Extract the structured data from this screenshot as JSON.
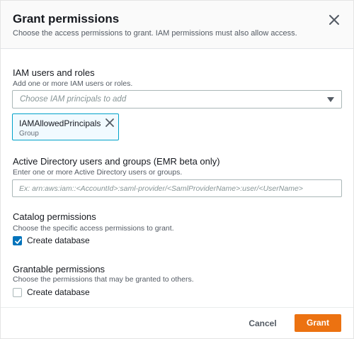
{
  "dialog": {
    "title": "Grant permissions",
    "subtitle": "Choose the access permissions to grant. IAM permissions must also allow access."
  },
  "iam": {
    "label": "IAM users and roles",
    "help": "Add one or more IAM users or roles.",
    "placeholder": "Choose IAM principals to add",
    "token": {
      "name": "IAMAllowedPrincipals",
      "type": "Group"
    }
  },
  "ad": {
    "label": "Active Directory users and groups (EMR beta only)",
    "help": "Enter one or more Active Directory users or groups.",
    "placeholder": "Ex: arn:aws:iam::<AccountId>:saml-provider/<SamlProviderName>:user/<UserName>",
    "value": ""
  },
  "catalog": {
    "label": "Catalog permissions",
    "help": "Choose the specific access permissions to grant.",
    "option": {
      "label": "Create database",
      "checked": true
    }
  },
  "grantable": {
    "label": "Grantable permissions",
    "help": "Choose the permissions that may be granted to others.",
    "option": {
      "label": "Create database",
      "checked": false
    }
  },
  "footer": {
    "cancel_label": "Cancel",
    "grant_label": "Grant"
  },
  "colors": {
    "primary_button": "#ec7211",
    "checkbox_checked": "#0073bb",
    "token_border": "#00a1c9"
  }
}
